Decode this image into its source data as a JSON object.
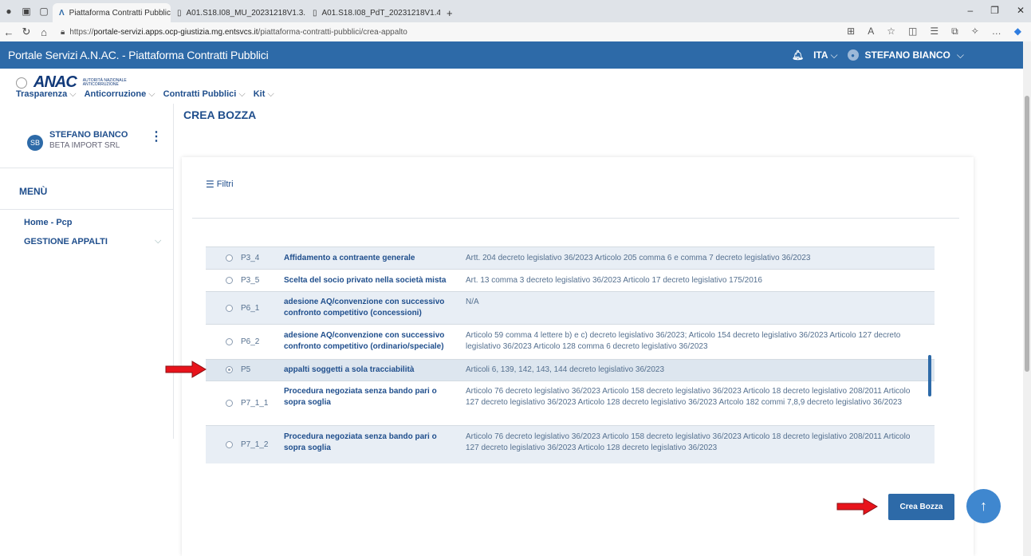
{
  "browser": {
    "tabs": [
      {
        "label": "Piattaforma Contratti Pubblici | P",
        "active": true
      },
      {
        "label": "A01.S18.I08_MU_20231218V1.3.",
        "active": false
      },
      {
        "label": "A01.S18.I08_PdT_20231218V1.4.",
        "active": false
      }
    ],
    "new_tab": "+",
    "url_prefix": "https://",
    "url_host": "portale-servizi.apps.ocp-giustizia.mg.entsvcs.it",
    "url_path": "/piattaforma-contratti-pubblici/crea-appalto"
  },
  "header": {
    "title": "Portale Servizi A.N.AC. - Piattaforma Contratti Pubblici",
    "language": "ITA",
    "user": "STEFANO BIANCO"
  },
  "logo": {
    "text": "ANAC",
    "subtitle": "AUTORITÀ NAZIONALE ANTICORRUZIONE"
  },
  "nav": {
    "items": [
      "Trasparenza",
      "Anticorruzione",
      "Contratti Pubblici",
      "Kit"
    ]
  },
  "sidebar": {
    "avatar_initials": "SB",
    "user_name": "STEFANO BIANCO",
    "org": "BETA IMPORT SRL",
    "menu_title": "MENÙ",
    "items": [
      "Home - Pcp",
      "GESTIONE APPALTI"
    ]
  },
  "main": {
    "page_title": "CREA BOZZA",
    "filter_label": "Filtri",
    "rows": [
      {
        "code": "P3_4",
        "name": "Affidamento a contraente generale",
        "desc": "Artt. 204 decreto legislativo 36/2023 Articolo 205 comma 6 e comma 7 decreto legislativo 36/2023",
        "selected": false
      },
      {
        "code": "P3_5",
        "name": "Scelta del socio privato nella società mista",
        "desc": "Art. 13 comma 3 decreto legislativo 36/2023 Articolo 17 decreto legislativo 175/2016",
        "selected": false
      },
      {
        "code": "P6_1",
        "name": "adesione AQ/convenzione con successivo confronto competitivo (concessioni)",
        "desc": "N/A",
        "selected": false
      },
      {
        "code": "P6_2",
        "name": "adesione AQ/convenzione con successivo confronto competitivo (ordinario/speciale)",
        "desc": "Articolo 59 comma 4 lettere b) e c) decreto legislativo 36/2023; Articolo 154 decreto legislativo 36/2023 Articolo 127 decreto legislativo 36/2023 Articolo 128 comma 6 decreto legislativo 36/2023",
        "selected": false
      },
      {
        "code": "P5",
        "name": "appalti soggetti a sola tracciabilità",
        "desc": "Articoli 6, 139, 142, 143, 144 decreto legislativo 36/2023",
        "selected": true
      },
      {
        "code": "P7_1_1",
        "name": "Procedura negoziata senza bando pari o sopra soglia",
        "desc": "Articolo 76 decreto legislativo 36/2023 Articolo 158 decreto legislativo 36/2023 Articolo 18 decreto legislativo 208/2011 Articolo 127 decreto legislativo 36/2023 Articolo 128 decreto legislativo 36/2023 Artcolo 182 commi 7,8,9 decreto legislativo 36/2023",
        "selected": false
      },
      {
        "code": "P7_1_2",
        "name": "Procedura negoziata senza bando pari o sopra soglia",
        "desc": "Articolo 76 decreto legislativo 36/2023 Articolo 158 decreto legislativo 36/2023 Articolo 18 decreto legislativo 208/2011 Articolo 127 decreto legislativo 36/2023 Articolo 128 decreto legislativo 36/2023",
        "selected": false
      }
    ],
    "create_button": "Crea Bozza"
  },
  "colors": {
    "header_bg": "#2d6aa8",
    "primary_text": "#1f4e8c",
    "arrow_red": "#e8131b",
    "row_alt": "#e8eef5"
  },
  "icons": {
    "filter": "filter-lines-icon",
    "up": "arrow-up-icon",
    "bell": "bell-icon",
    "chevron": "chevron-down-icon"
  }
}
